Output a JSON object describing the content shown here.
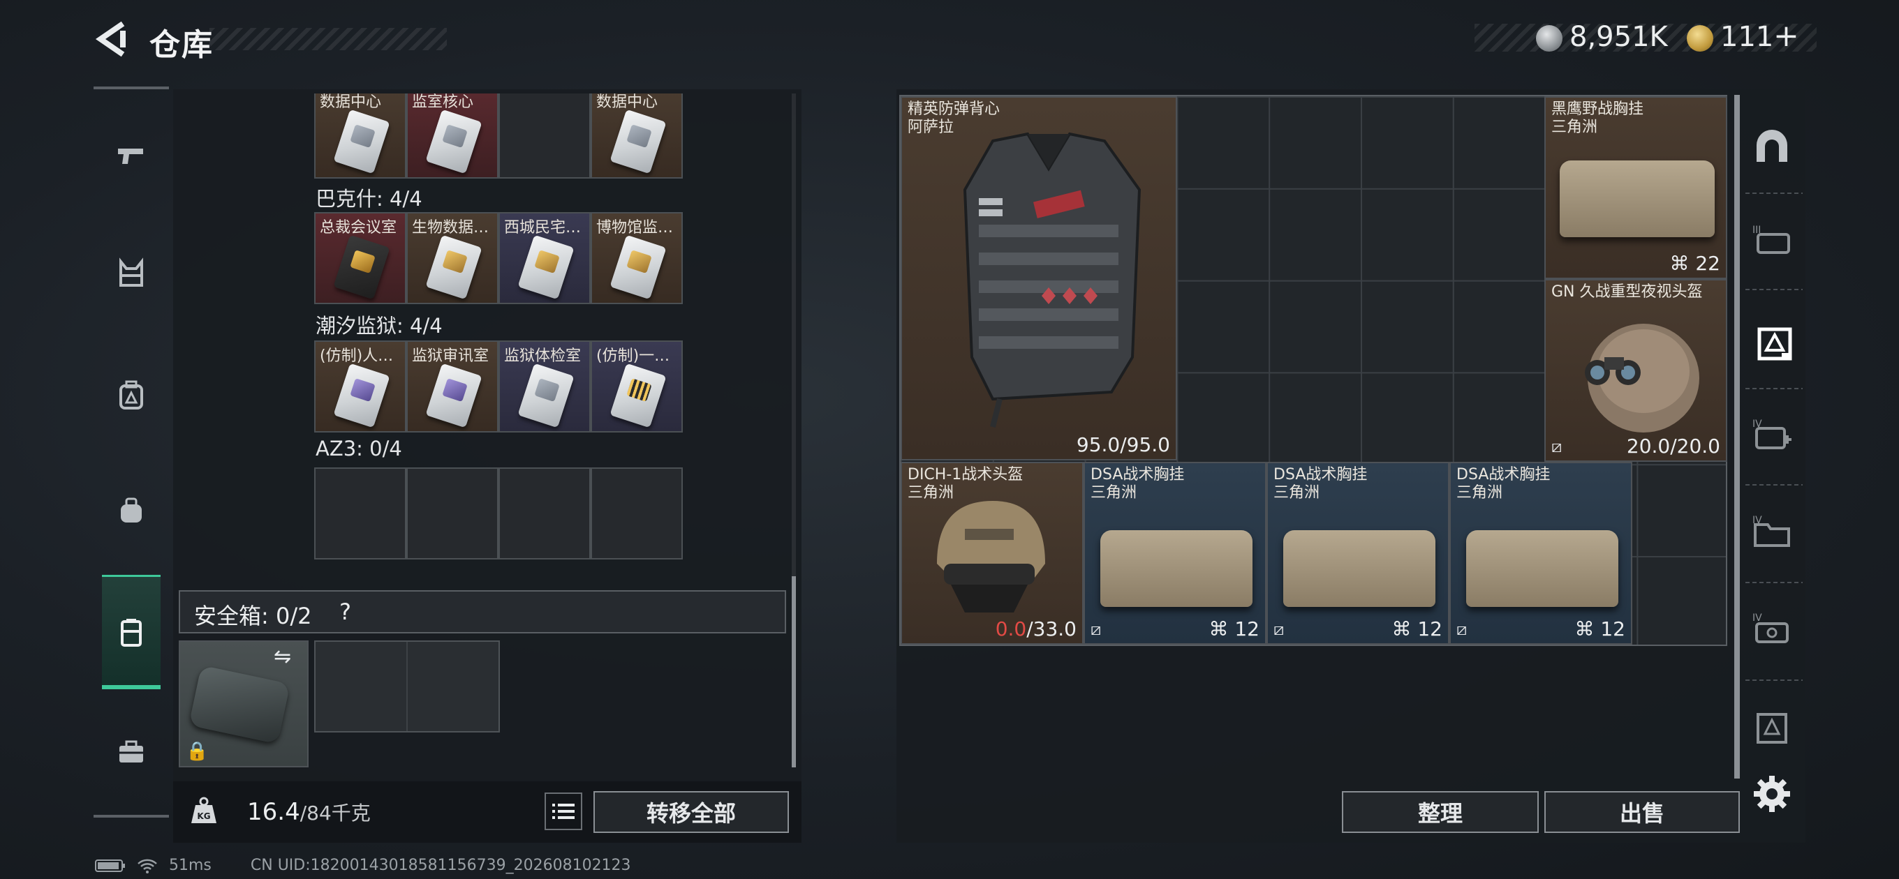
{
  "header": {
    "title": "仓库",
    "currency_silver": "8,951K",
    "currency_gold": "111",
    "plus": "+"
  },
  "key_groups": [
    {
      "rows": [
        [
          "数据中心",
          "监室核心",
          "",
          "数据中心"
        ]
      ]
    },
    {
      "label": "巴克什: 4/4",
      "cells": [
        "总裁会议室",
        "生物数据…",
        "西城民宅…",
        "博物馆监…"
      ]
    },
    {
      "label": "潮汐监狱: 4/4",
      "cells": [
        "(仿制)人…",
        "监狱审讯室",
        "监狱体检室",
        "(仿制)一…"
      ]
    },
    {
      "label": "AZ3: 0/4",
      "cells": [
        "",
        "",
        "",
        ""
      ]
    }
  ],
  "safebox": {
    "label": "安全箱: 0/2",
    "help": "?",
    "swap": "⇋",
    "lock": "🔒"
  },
  "bottom": {
    "weight": "16.4",
    "weight_max": "/84千克",
    "kg_label": "KG",
    "transfer": "转移全部"
  },
  "items": [
    {
      "name": "精英防弹背心\n阿萨拉",
      "durability": "95.0/95.0"
    },
    {
      "name": "黑鹰野战胸挂\n三角洲",
      "capacity": "22"
    },
    {
      "name": "GN 久战重型夜视头盔",
      "durability": "20.0/20.0"
    },
    {
      "name": "DICH-1战术头盔\n三角洲",
      "durability_cur": "0.0",
      "durability_max": "/33.0"
    },
    {
      "name": "DSA战术胸挂\n三角洲",
      "capacity": "12"
    },
    {
      "name": "DSA战术胸挂\n三角洲",
      "capacity": "12"
    },
    {
      "name": "DSA战术胸挂\n三角洲",
      "capacity": "12"
    }
  ],
  "right_rail_levels": [
    "III",
    "IV",
    "IV",
    "IV"
  ],
  "actions": {
    "sort": "整理",
    "sell": "出售"
  },
  "status": {
    "ping": "51ms",
    "uid": "CN UID:18200143018581156739_202608102123"
  },
  "colors": {
    "accent_green": "#3ec99a",
    "durability_zero": "#e24a45"
  }
}
